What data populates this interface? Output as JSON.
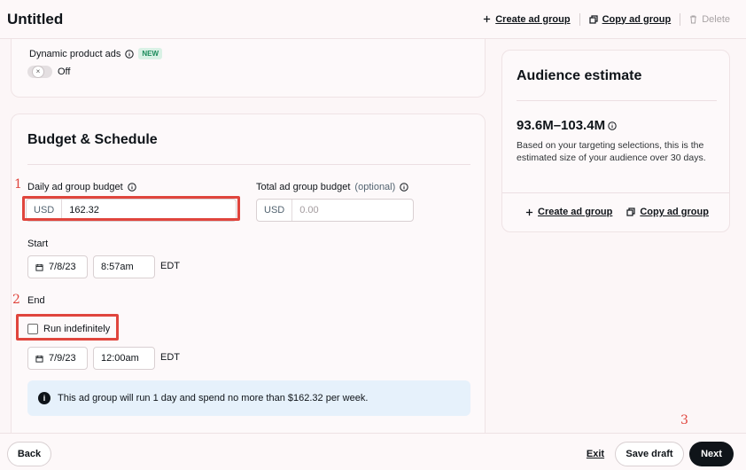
{
  "header": {
    "title": "Untitled",
    "create_ad_group": "Create ad group",
    "copy_ad_group": "Copy ad group",
    "delete": "Delete"
  },
  "dpa": {
    "label": "Dynamic product ads",
    "badge": "NEW",
    "toggle_state": "Off"
  },
  "budget": {
    "section_title": "Budget & Schedule",
    "daily_label": "Daily ad group budget",
    "daily_currency": "USD",
    "daily_value": "162.32",
    "total_label": "Total ad group budget",
    "total_optional": "(optional)",
    "total_currency": "USD",
    "total_placeholder": "0.00",
    "start_label": "Start",
    "start_date": "7/8/23",
    "start_time": "8:57am",
    "start_tz": "EDT",
    "end_label": "End",
    "run_indefinitely": "Run indefinitely",
    "end_date": "7/9/23",
    "end_time": "12:00am",
    "end_tz": "EDT",
    "info_text": "This ad group will run 1 day and spend no more than $162.32 per week."
  },
  "audience": {
    "title": "Audience estimate",
    "range": "93.6M–103.4M",
    "description": "Based on your targeting selections, this is the estimated size of your audience over 30 days.",
    "create_ad_group": "Create ad group",
    "copy_ad_group": "Copy ad group"
  },
  "annotations": {
    "one": "1",
    "two": "2",
    "three": "3"
  },
  "footer": {
    "back": "Back",
    "exit": "Exit",
    "save_draft": "Save draft",
    "next": "Next"
  },
  "colors": {
    "accent_red": "#e0453d",
    "primary_dark": "#0f1419",
    "info_bg": "#e6f1fb"
  }
}
